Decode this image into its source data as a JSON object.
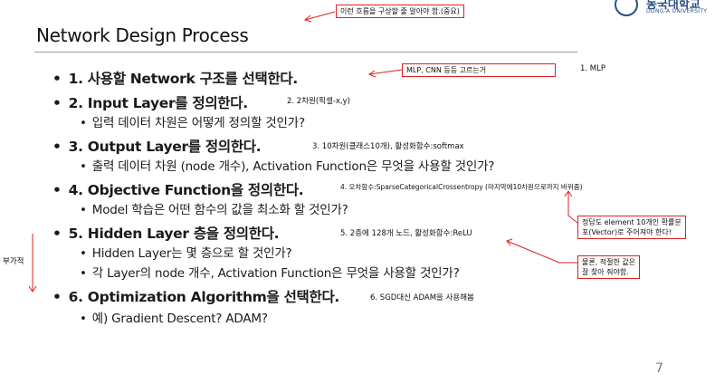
{
  "header": {
    "title": "Network Design Process",
    "logo_text_ko": "동국대학교",
    "logo_text_en": "DONG-A UNIVERSITY"
  },
  "steps": [
    {
      "main": "1. 사용할 Network 구조를 선택한다.",
      "note": "",
      "subs": []
    },
    {
      "main": "2. Input Layer를 정의한다.",
      "note": "2. 2차원(픽셀-x,y)",
      "subs": [
        "입력 데이터 차원은 어떻게 정의할 것인가?"
      ]
    },
    {
      "main": "3. Output Layer를 정의한다.",
      "note": "3. 10차원(클래스10개), 활성화함수:softmax",
      "subs": [
        "출력 데이터 차원 (node 개수), Activation Function은 무엇을 사용할 것인가?"
      ]
    },
    {
      "main": "4. Objective Function을 정의한다.",
      "note": "4. 오차함수:SparseCategoricalCrossentropy (마지막에10차원으로까지 바뀌줌)",
      "subs": [
        "Model 학습은 어떤 함수의 값을 최소화 할 것인가?"
      ]
    },
    {
      "main": "5. Hidden Layer 층을 정의한다.",
      "note": "5. 2층에 128개 노드, 활성화함수:ReLU",
      "subs": [
        "Hidden Layer는 몇 층으로 할 것인가?",
        "각 Layer의 node 개수, Activation Function은 무엇을 사용할 것인가?"
      ]
    },
    {
      "main": "6. Optimization Algorithm을 선택한다.",
      "note": "6. SGD대신 ADAM을 사용해봄",
      "subs": [
        "예) Gradient Descent?  ADAM?"
      ]
    }
  ],
  "annotations": {
    "top_box": "이런 흐름을 구상할 줄 알아야 함.(중요)",
    "mlp_box": "MLP, CNN 등등 고르는거",
    "mlp_note": "1. MLP",
    "element_box_line1": "정답도 element 10개인 확률분",
    "element_box_line2": "포(Vector)로 주어져야 한다!",
    "relu_box_line1": "물론, 적절한 값은",
    "relu_box_line2": "잘 찾아 줘야함.",
    "side_label": "부가적"
  },
  "page_number": "7",
  "colors": {
    "annotation_red": "#dd2222",
    "logo_blue": "#2e4e88"
  }
}
